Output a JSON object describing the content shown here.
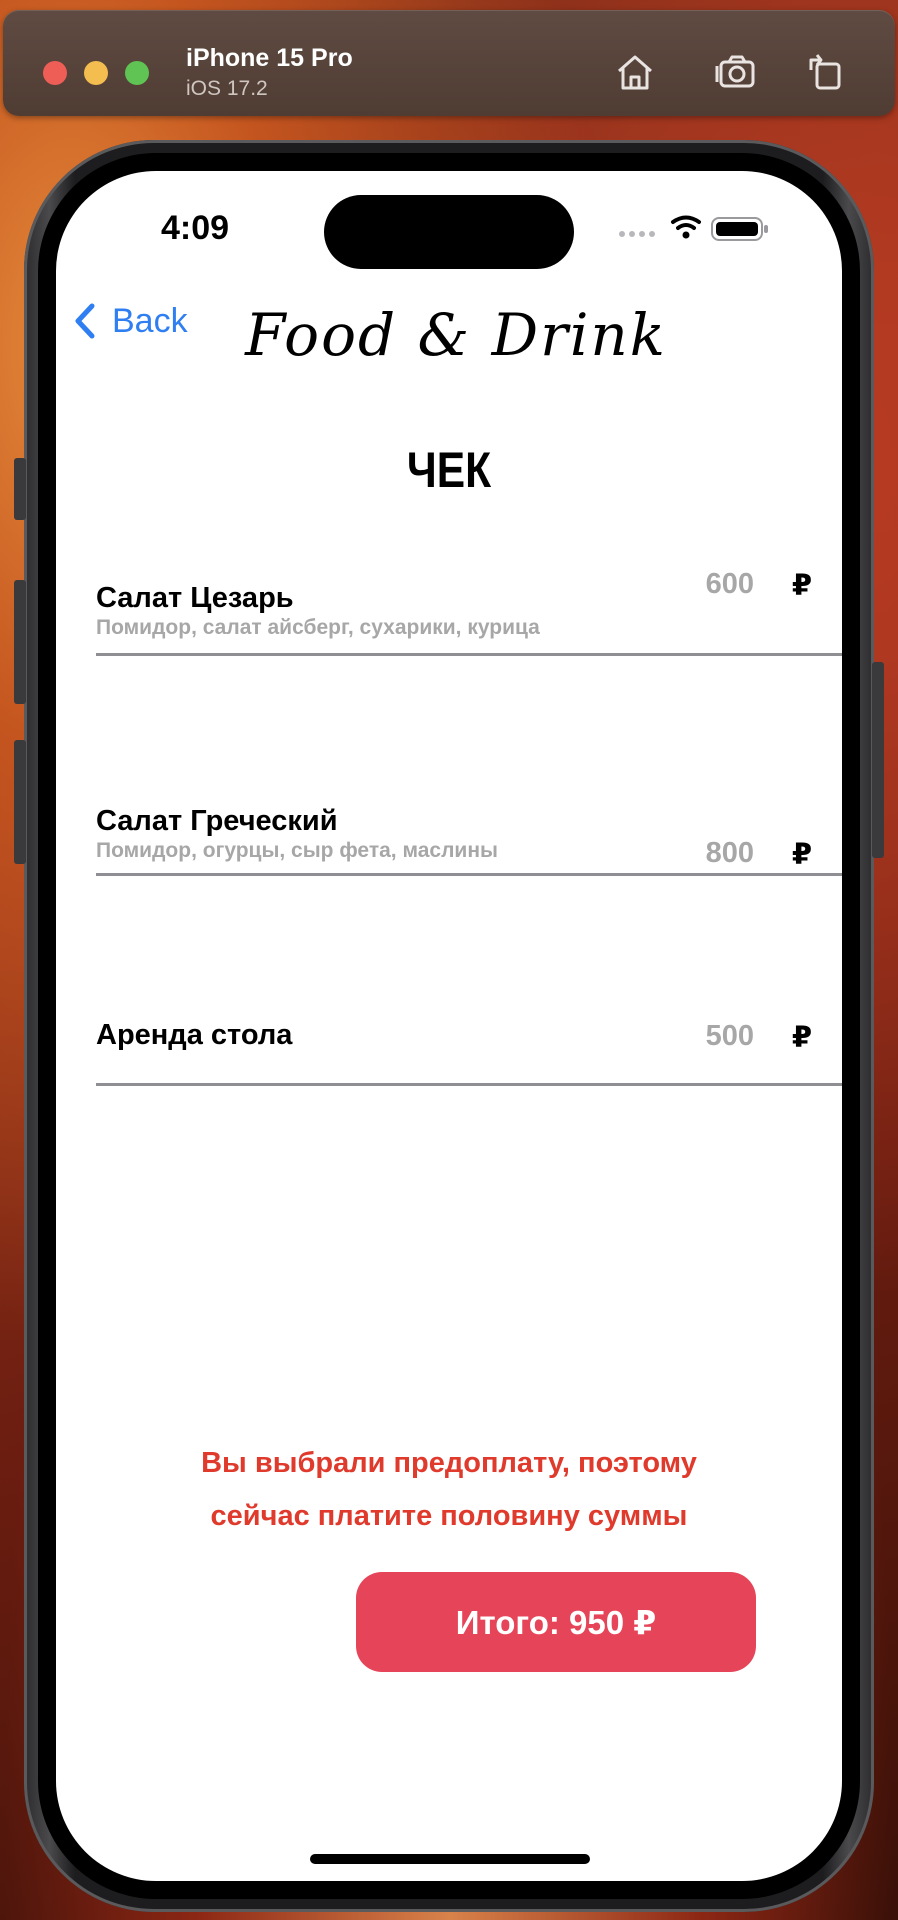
{
  "simulator": {
    "device_name": "iPhone 15 Pro",
    "os_version": "iOS 17.2",
    "icons": [
      "home-icon",
      "screenshot-icon",
      "rotate-icon"
    ]
  },
  "status_bar": {
    "time": "4:09"
  },
  "nav": {
    "back_label": "Back",
    "brand": "Food & Drink"
  },
  "receipt": {
    "title": "ЧЕК",
    "items": [
      {
        "name": "Салат Цезарь",
        "description": "Помидор, салат айсберг, сухарики, курица",
        "price": "600",
        "currency": "₽"
      },
      {
        "name": "Салат Греческий",
        "description": "Помидор, огурцы, сыр фета, маслины",
        "price": "800",
        "currency": "₽"
      },
      {
        "name": "Аренда стола",
        "description": "",
        "price": "500",
        "currency": "₽"
      }
    ],
    "notice_line1": "Вы выбрали предоплату, поэтому",
    "notice_line2": "сейчас платите половину суммы",
    "total_label": "Итого: 950 ₽"
  },
  "colors": {
    "accent_blue": "#2f7ff2",
    "notice_red": "#df3a2c",
    "total_button": "#e64458",
    "muted_text": "#a7a7a7"
  }
}
